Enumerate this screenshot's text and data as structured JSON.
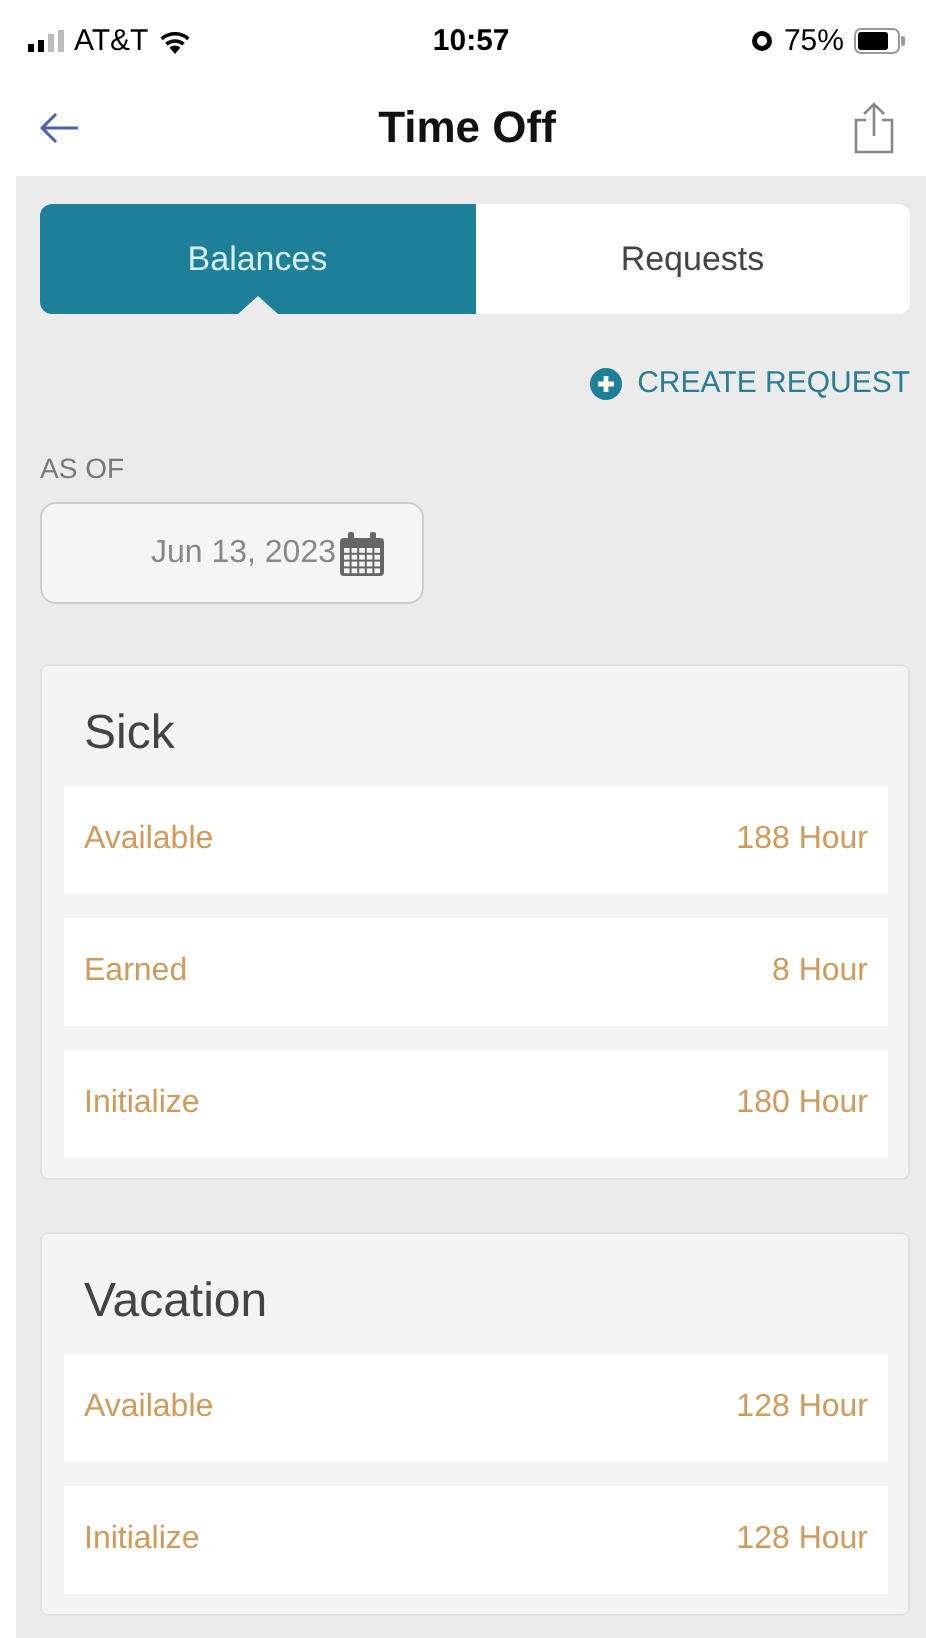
{
  "status_bar": {
    "carrier": "AT&T",
    "time": "10:57",
    "battery": "75%"
  },
  "nav": {
    "title": "Time Off"
  },
  "tabs": [
    {
      "label": "Balances",
      "selected": true
    },
    {
      "label": "Requests",
      "selected": false
    }
  ],
  "create_request": "CREATE REQUEST",
  "as_of": {
    "label": "AS OF",
    "value": "Jun 13, 2023"
  },
  "balances": [
    {
      "title": "Sick",
      "rows": [
        {
          "label": "Available",
          "value": "188 Hour"
        },
        {
          "label": "Earned",
          "value": "8 Hour"
        },
        {
          "label": "Initialize",
          "value": "180 Hour"
        }
      ]
    },
    {
      "title": "Vacation",
      "rows": [
        {
          "label": "Available",
          "value": "128 Hour"
        },
        {
          "label": "Initialize",
          "value": "128 Hour"
        }
      ]
    }
  ]
}
